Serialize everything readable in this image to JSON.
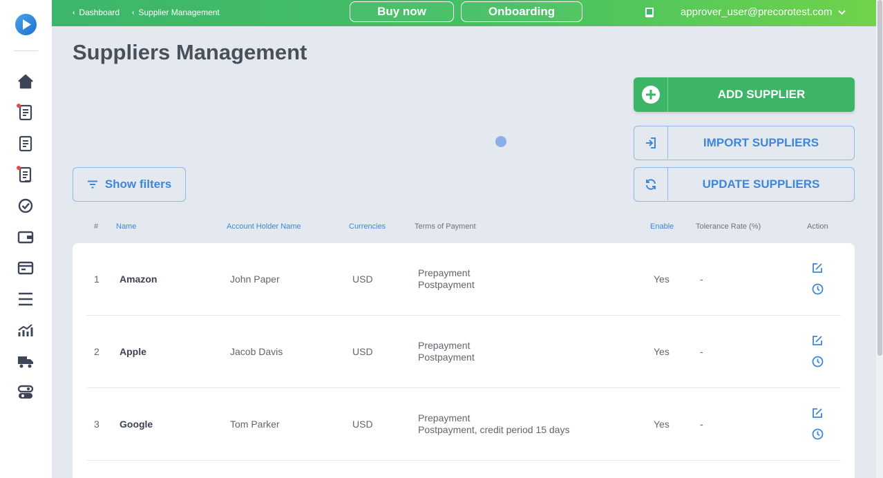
{
  "breadcrumbs": [
    "Dashboard",
    "Supplier Management"
  ],
  "topbar": {
    "buy_now": "Buy now",
    "onboarding": "Onboarding",
    "user_email": "approver_user@precorotest.com"
  },
  "page_title": "Suppliers Management",
  "buttons": {
    "add_supplier": "ADD SUPPLIER",
    "import_suppliers": "IMPORT SUPPLIERS",
    "update_suppliers": "UPDATE SUPPLIERS",
    "show_filters": "Show filters"
  },
  "table": {
    "headers": {
      "num": "#",
      "name": "Name",
      "account_holder": "Account Holder Name",
      "currencies": "Currencies",
      "terms": "Terms of Payment",
      "enable": "Enable",
      "tolerance": "Tolerance Rate (%)",
      "action": "Action"
    },
    "rows": [
      {
        "num": "1",
        "name": "Amazon",
        "holder": "John Paper",
        "currency": "USD",
        "terms1": "Prepayment",
        "terms2": "Postpayment",
        "enable": "Yes",
        "tolerance": "-"
      },
      {
        "num": "2",
        "name": "Apple",
        "holder": "Jacob Davis",
        "currency": "USD",
        "terms1": "Prepayment",
        "terms2": "Postpayment",
        "enable": "Yes",
        "tolerance": "-"
      },
      {
        "num": "3",
        "name": "Google",
        "holder": "Tom Parker",
        "currency": "USD",
        "terms1": "Prepayment",
        "terms2": "Postpayment, credit period 15 days",
        "enable": "Yes",
        "tolerance": "-"
      }
    ]
  },
  "colors": {
    "accent_green": "#3cb567",
    "accent_blue": "#3e86d9",
    "nav_icon": "#3d4556"
  },
  "icons": [
    "logo-icon",
    "home-icon",
    "requisition-icon",
    "purchase-order-icon",
    "invoice-icon",
    "approval-icon",
    "wallet-icon",
    "card-icon",
    "menu-icon",
    "analytics-icon",
    "delivery-icon",
    "settings-icon",
    "book-icon",
    "edit-icon",
    "history-icon"
  ]
}
